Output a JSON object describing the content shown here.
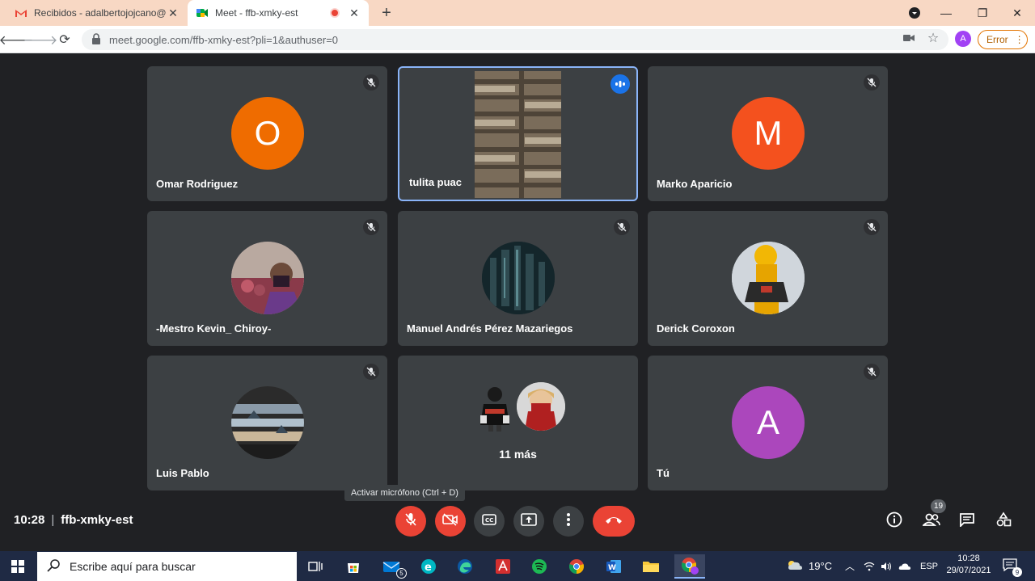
{
  "browser": {
    "tabs": [
      {
        "title": "Recibidos - adalbertojojcano@gr",
        "active": false
      },
      {
        "title": "Meet - ffb-xmky-est",
        "active": true
      }
    ],
    "url": "meet.google.com/ffb-xmky-est?pli=1&authuser=0",
    "profile_initial": "A",
    "error_label": "Error"
  },
  "meet": {
    "participants": [
      {
        "name": "Omar Rodriguez",
        "initial": "O",
        "color": "#ef6c00"
      },
      {
        "name": "tulita puac",
        "speaking": true
      },
      {
        "name": "Marko Aparicio",
        "initial": "M",
        "color": "#f4511e"
      },
      {
        "name": "-Mestro Kevin_ Chiroy-"
      },
      {
        "name": "Manuel Andrés Pérez Mazariegos"
      },
      {
        "name": "Derick Coroxon"
      },
      {
        "name": "Luis Pablo"
      },
      {
        "name": "Tú",
        "initial": "A",
        "color": "#ab47bc"
      }
    ],
    "more_label": "11 más",
    "tooltip": "Activar micrófono (Ctrl + D)",
    "time": "10:28",
    "meeting_code": "ffb-xmky-est",
    "participants_count": "19"
  },
  "taskbar": {
    "search_placeholder": "Escribe aquí para buscar",
    "mail_badge": "5",
    "temperature": "19°C",
    "language": "ESP",
    "clock_time": "10:28",
    "clock_date": "29/07/2021",
    "notifications_count": "9"
  }
}
